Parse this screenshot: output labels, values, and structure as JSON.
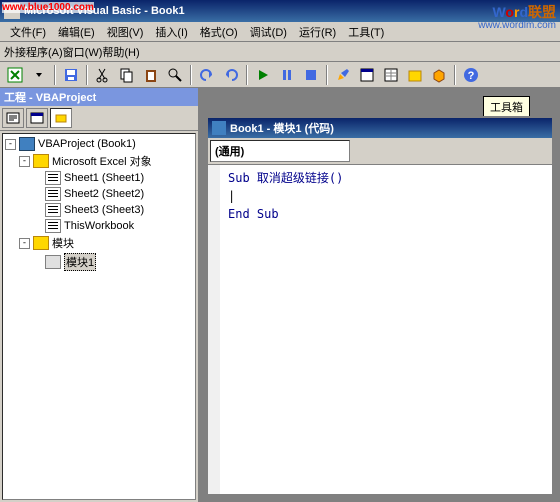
{
  "watermarks": {
    "topleft": "www.blue1000.com",
    "topright_word": "Word",
    "topright_lm": "联盟",
    "url": "www.wordlm.com"
  },
  "titlebar": {
    "title": "Microsoft Visual Basic - Book1"
  },
  "menu": {
    "file": "文件(F)",
    "edit": "编辑(E)",
    "view": "视图(V)",
    "insert": "插入(I)",
    "format": "格式(O)",
    "debug": "调试(D)",
    "run": "运行(R)",
    "tools": "工具(T)",
    "addin": "外接程序(A)",
    "window": "窗口(W)",
    "help": "帮助(H)"
  },
  "toolbox_tooltip": "工具箱",
  "project_panel": {
    "title": "工程 - VBAProject",
    "root": "VBAProject (Book1)",
    "excel_objects": "Microsoft Excel 对象",
    "sheet1": "Sheet1 (Sheet1)",
    "sheet2": "Sheet2 (Sheet2)",
    "sheet3": "Sheet3 (Sheet3)",
    "thisworkbook": "ThisWorkbook",
    "modules": "模块",
    "module1": "模块1"
  },
  "code_window": {
    "title": "Book1 - 模块1 (代码)",
    "dropdown": "(通用)",
    "code_lines": [
      "Sub 取消超级链接()",
      "|",
      "End Sub"
    ]
  }
}
